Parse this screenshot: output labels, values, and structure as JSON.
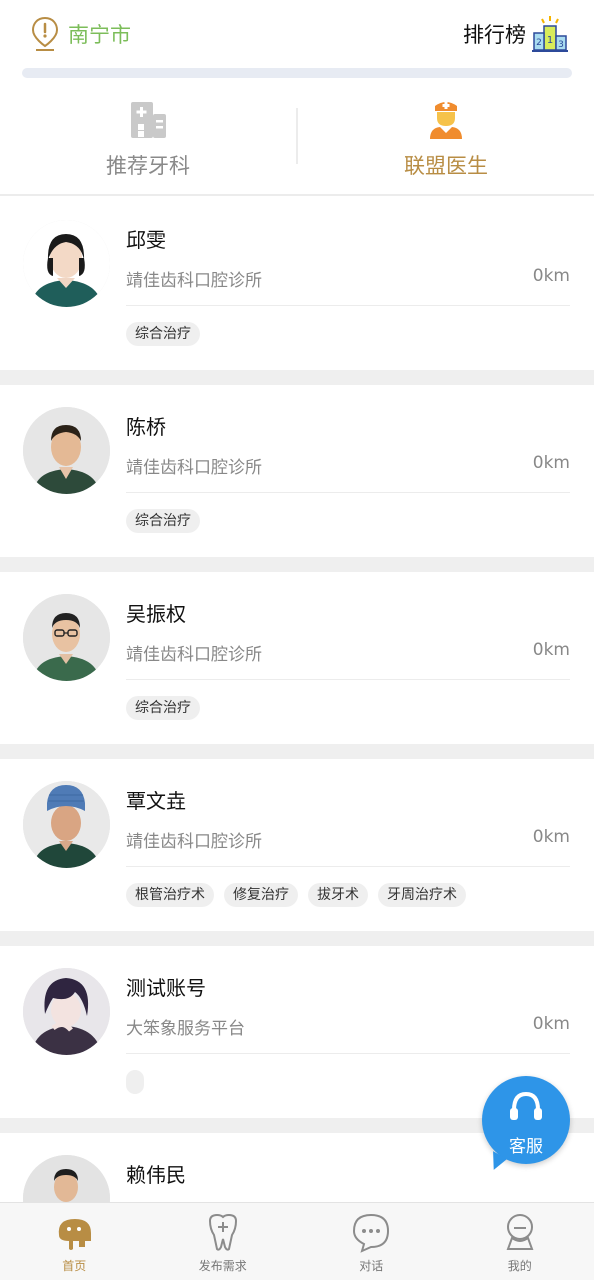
{
  "header": {
    "city": "南宁市",
    "ranking_label": "排行榜",
    "ranking_icon": "podium-icon",
    "location_icon": "location-pin-icon"
  },
  "tabs": [
    {
      "label": "推荐牙科",
      "icon": "hospital-icon",
      "active": false
    },
    {
      "label": "联盟医生",
      "icon": "doctor-icon",
      "active": true
    }
  ],
  "doctors": [
    {
      "name": "邱雯",
      "clinic": "靖佳齿科口腔诊所",
      "distance": "0km",
      "tags": [
        "综合治疗"
      ]
    },
    {
      "name": "陈桥",
      "clinic": "靖佳齿科口腔诊所",
      "distance": "0km",
      "tags": [
        "综合治疗"
      ]
    },
    {
      "name": "吴振权",
      "clinic": "靖佳齿科口腔诊所",
      "distance": "0km",
      "tags": [
        "综合治疗"
      ]
    },
    {
      "name": "覃文垚",
      "clinic": "靖佳齿科口腔诊所",
      "distance": "0km",
      "tags": [
        "根管治疗术",
        "修复治疗",
        "拔牙术",
        "牙周治疗术"
      ]
    },
    {
      "name": "测试账号",
      "clinic": "大笨象服务平台",
      "distance": "0km",
      "tags": [
        ""
      ]
    },
    {
      "name": "赖伟民",
      "clinic": "",
      "distance": "",
      "tags": []
    }
  ],
  "float_button": {
    "label": "客服",
    "icon": "headset-icon"
  },
  "bottom_nav": [
    {
      "label": "首页",
      "icon": "home-elephant-icon",
      "active": true
    },
    {
      "label": "发布需求",
      "icon": "tooth-plus-icon",
      "active": false
    },
    {
      "label": "对话",
      "icon": "chat-icon",
      "active": false
    },
    {
      "label": "我的",
      "icon": "profile-icon",
      "active": false
    }
  ],
  "colors": {
    "accent_gold": "#b88d44",
    "city_green": "#7cbd5a",
    "float_blue": "#2e95e8"
  }
}
